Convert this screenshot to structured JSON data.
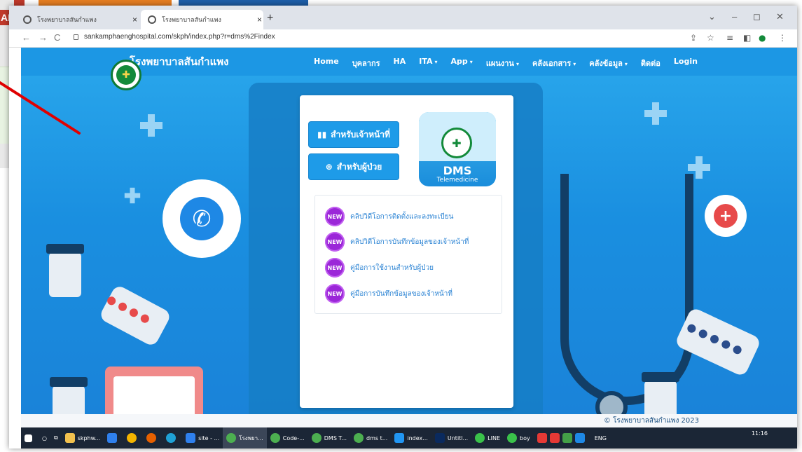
{
  "browser": {
    "tabs": [
      {
        "label": "โรงพยาบาลสันกำแพง",
        "active": false
      },
      {
        "label": "โรงพยาบาลสันกำแพง",
        "active": true
      }
    ],
    "url": "sankamphaenghospital.com/skph/index.php?r=dms%2Findex"
  },
  "site": {
    "brand": "โรงพยาบาลสันกำแพง",
    "menu": [
      {
        "label": "Home",
        "dropdown": false
      },
      {
        "label": "บุคลากร",
        "dropdown": false
      },
      {
        "label": "HA",
        "dropdown": false
      },
      {
        "label": "ITA",
        "dropdown": true
      },
      {
        "label": "App",
        "dropdown": true
      },
      {
        "label": "แผนงาน",
        "dropdown": true
      },
      {
        "label": "คลังเอกสาร",
        "dropdown": true
      },
      {
        "label": "คลังข้อมูล",
        "dropdown": true
      },
      {
        "label": "ติดต่อ",
        "dropdown": false
      },
      {
        "label": "Login",
        "dropdown": false
      }
    ]
  },
  "card": {
    "staff_button": "สำหรับเจ้าหน้าที่",
    "patient_button": "สำหรับผู้ป่วย",
    "dms_title": "DMS",
    "dms_subtitle": "Telemedicine",
    "badge_label": "NEW",
    "links": [
      "คลิปวิดีโอการติดตั้งและลงทะเบียน",
      "คลิปวิดีโอการบันทึกข้อมูลของเจ้าหน้าที่",
      "คู่มือการใช้งานสำหรับผู้ป่วย",
      "คู่มือการบันทึกข้อมูลของเจ้าหน้าที่"
    ]
  },
  "footer": {
    "text": "© โรงพยาบาลสันกำแพง 2023"
  },
  "taskbar": {
    "items": [
      "skphw...",
      "site - ...",
      "โรงพยา...",
      "Code-...",
      "DMS T...",
      "dms t...",
      "index...",
      "Untitl...",
      "LINE",
      "boy"
    ],
    "language": "ENG",
    "time": "11:16"
  },
  "background": {
    "corner_text": "AR"
  },
  "colors": {
    "page_blue": "#1a8fe0",
    "nav_blue": "#1c97e4",
    "button_blue": "#1e9be8",
    "new_badge": "#9b27d8",
    "link_text": "#2c84d4",
    "annotation_red": "#e00000"
  }
}
